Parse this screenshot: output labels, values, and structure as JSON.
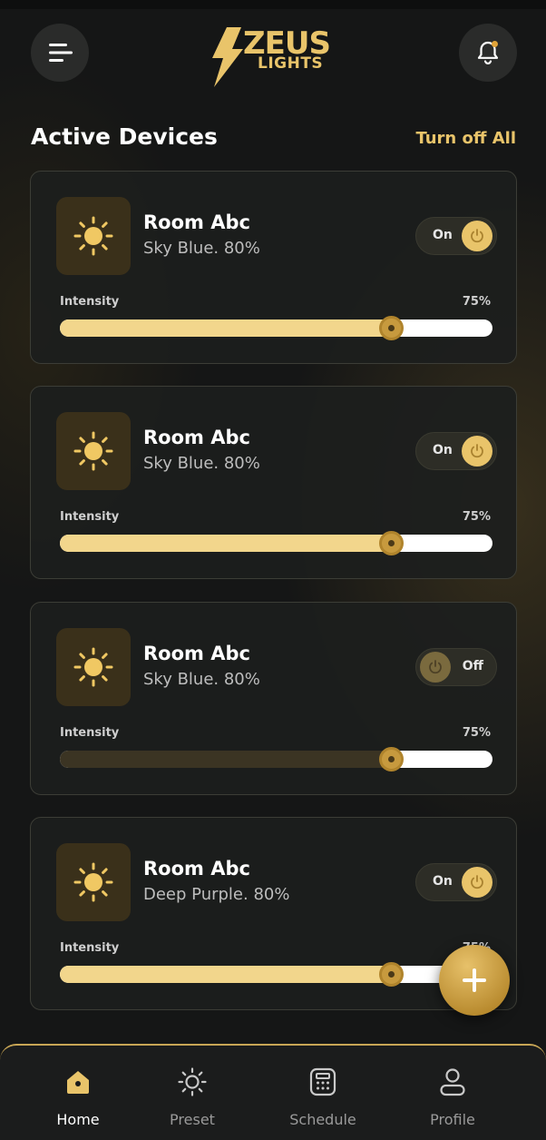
{
  "app": {
    "logo_main": "ZEUS",
    "logo_sub": "LIGHTS"
  },
  "header": {
    "menu_icon": "menu-icon",
    "bell_icon": "bell-icon"
  },
  "section": {
    "title": "Active Devices",
    "turn_off_all": "Turn off All"
  },
  "devices": [
    {
      "name": "Room Abc",
      "subtitle": "Sky Blue. 80%",
      "state": "on",
      "toggle_label": "On",
      "intensity_label": "Intensity",
      "intensity_text": "75%",
      "intensity": 0.765
    },
    {
      "name": "Room Abc",
      "subtitle": "Sky Blue. 80%",
      "state": "on",
      "toggle_label": "On",
      "intensity_label": "Intensity",
      "intensity_text": "75%",
      "intensity": 0.765
    },
    {
      "name": "Room Abc",
      "subtitle": "Sky Blue. 80%",
      "state": "off",
      "toggle_label": "Off",
      "intensity_label": "Intensity",
      "intensity_text": "75%",
      "intensity": 0.765
    },
    {
      "name": "Room Abc",
      "subtitle": "Deep Purple. 80%",
      "state": "on",
      "toggle_label": "On",
      "intensity_label": "Intensity",
      "intensity_text": "75%",
      "intensity": 0.765
    }
  ],
  "fab": {
    "icon": "plus-icon"
  },
  "nav": {
    "items": [
      {
        "label": "Home",
        "icon": "home-icon",
        "active": true
      },
      {
        "label": "Preset",
        "icon": "sun-icon",
        "active": false
      },
      {
        "label": "Schedule",
        "icon": "calendar-icon",
        "active": false
      },
      {
        "label": "Profile",
        "icon": "user-icon",
        "active": false
      }
    ]
  },
  "colors": {
    "accent": "#e9c46a",
    "background": "#151616",
    "card": "#1c1e1d",
    "slider_fill": "#f2d68c"
  }
}
